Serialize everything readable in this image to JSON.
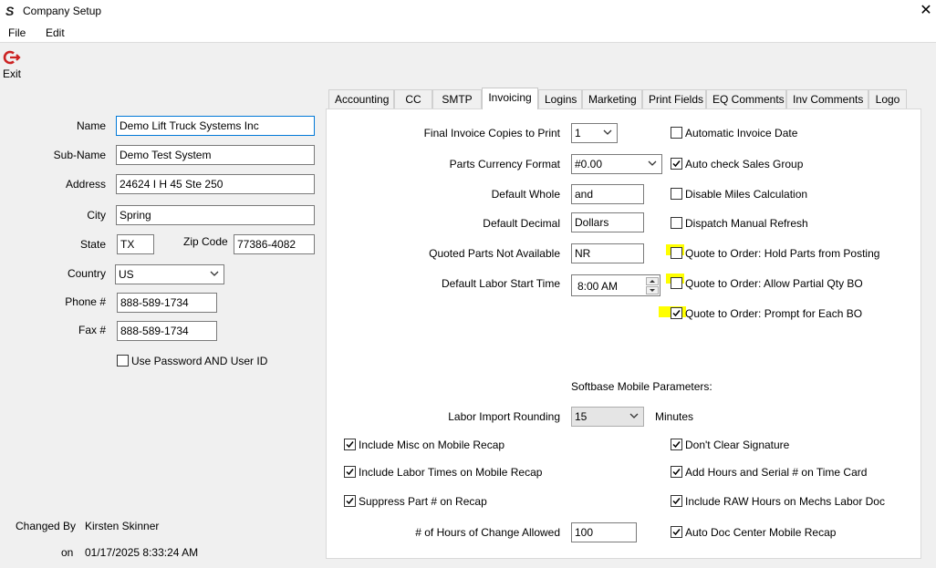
{
  "window": {
    "title": "Company Setup",
    "close_glyph": "✕",
    "icon": "softbase-s-icon"
  },
  "menu": {
    "file": "File",
    "edit": "Edit"
  },
  "toolbar": {
    "exit_label": "Exit",
    "exit_icon": "exit-icon",
    "exit_color": "#cc2222"
  },
  "company": {
    "name_label": "Name",
    "name_value": "Demo Lift Truck Systems Inc",
    "subname_label": "Sub-Name",
    "subname_value": "Demo Test System",
    "address_label": "Address",
    "address_value": "24624 I H 45 Ste 250",
    "city_label": "City",
    "city_value": "Spring",
    "state_label": "State",
    "state_value": "TX",
    "zip_label": "Zip Code",
    "zip_value": "77386-4082",
    "country_label": "Country",
    "country_value": "US",
    "phone_label": "Phone #",
    "phone_value": "888-589-1734",
    "fax_label": "Fax #",
    "fax_value": "888-589-1734",
    "use_password_label": "Use Password AND User ID",
    "use_password_checked": false
  },
  "audit": {
    "changed_by_label": "Changed By",
    "changed_by_value": "Kirsten Skinner",
    "on_label": "on",
    "on_value": "01/17/2025 8:33:24 AM"
  },
  "tabs": [
    {
      "label": "Accounting",
      "active": false
    },
    {
      "label": "CC",
      "active": false
    },
    {
      "label": "SMTP",
      "active": false
    },
    {
      "label": "Invoicing",
      "active": true
    },
    {
      "label": "Logins",
      "active": false
    },
    {
      "label": "Marketing",
      "active": false
    },
    {
      "label": "Print Fields",
      "active": false
    },
    {
      "label": "EQ Comments",
      "active": false
    },
    {
      "label": "Inv Comments",
      "active": false
    },
    {
      "label": "Logo",
      "active": false
    }
  ],
  "invoicing": {
    "copies_label": "Final Invoice Copies to Print",
    "copies_value": "1",
    "currency_label": "Parts Currency Format",
    "currency_value": "#0.00",
    "whole_label": "Default Whole",
    "whole_value": "and",
    "decimal_label": "Default Decimal",
    "decimal_value": "Dollars",
    "qpna_label": "Quoted Parts Not Available",
    "qpna_value": "NR",
    "labor_start_label": "Default Labor Start Time",
    "labor_start_value": "8:00 AM",
    "checks_right": [
      {
        "label": "Automatic Invoice Date",
        "checked": false,
        "highlighted": false
      },
      {
        "label": "Auto check Sales Group",
        "checked": true,
        "highlighted": false
      },
      {
        "label": "Disable Miles Calculation",
        "checked": false,
        "highlighted": false
      },
      {
        "label": "Dispatch Manual Refresh",
        "checked": false,
        "highlighted": false
      },
      {
        "label": "Quote to Order: Hold Parts from Posting",
        "checked": false,
        "highlighted": true
      },
      {
        "label": "Quote to Order: Allow Partial Qty BO",
        "checked": false,
        "highlighted": true
      },
      {
        "label": "Quote to Order: Prompt for Each BO",
        "checked": true,
        "highlighted": true
      }
    ],
    "mobile_heading": "Softbase Mobile Parameters:",
    "rounding_label": "Labor Import Rounding",
    "rounding_value": "15",
    "rounding_unit": "Minutes",
    "mobile_left": [
      {
        "label": "Include Misc on Mobile Recap",
        "checked": true
      },
      {
        "label": "Include Labor Times on Mobile Recap",
        "checked": true
      },
      {
        "label": "Suppress Part # on Recap",
        "checked": true
      }
    ],
    "mobile_right": [
      {
        "label": "Don't Clear Signature",
        "checked": true
      },
      {
        "label": "Add Hours and Serial # on Time Card",
        "checked": true
      },
      {
        "label": "Include RAW Hours on Mechs Labor Doc",
        "checked": true
      },
      {
        "label": "Auto Doc Center Mobile Recap",
        "checked": true
      }
    ],
    "hours_change_label": "# of Hours of Change Allowed",
    "hours_change_value": "100"
  },
  "colors": {
    "highlight": "#ffff00",
    "focus_border": "#0078d7"
  }
}
